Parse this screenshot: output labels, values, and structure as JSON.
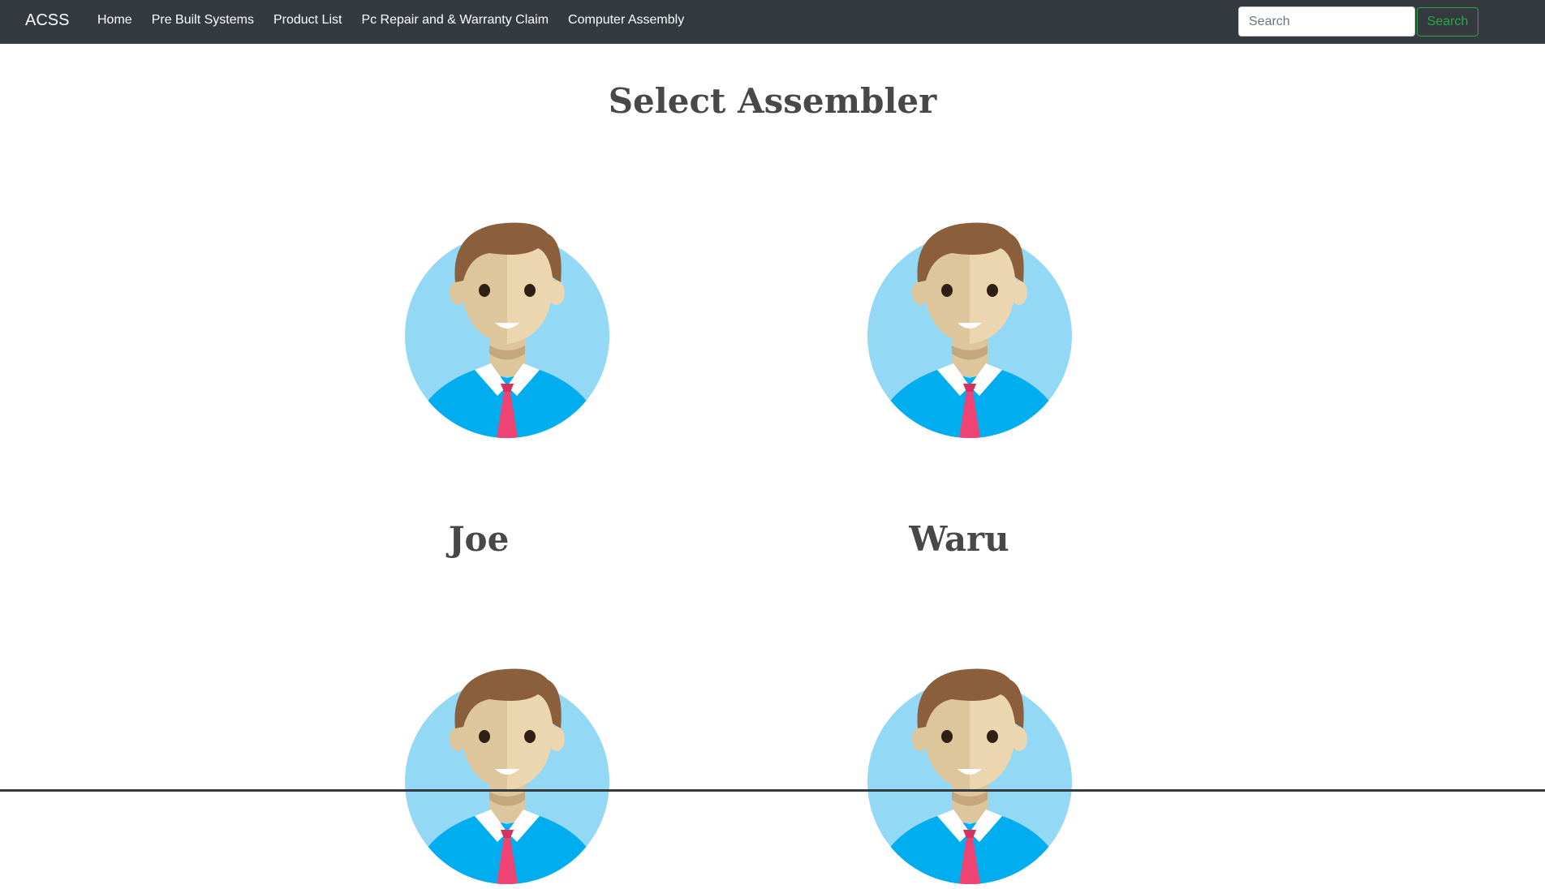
{
  "navbar": {
    "brand": "ACSS",
    "links": [
      {
        "label": "Home"
      },
      {
        "label": "Pre Built Systems"
      },
      {
        "label": "Product List"
      },
      {
        "label": "Pc Repair and & Warranty Claim"
      },
      {
        "label": "Computer Assembly"
      }
    ],
    "search": {
      "placeholder": "Search",
      "value": "",
      "button_label": "Search"
    },
    "colors": {
      "background": "#343a40",
      "search_button": "#28a745"
    }
  },
  "main": {
    "title": "Select Assembler",
    "assemblers": [
      {
        "name": "Joe",
        "avatar_icon": "male-avatar-icon"
      },
      {
        "name": "Waru",
        "avatar_icon": "male-avatar-icon"
      },
      {
        "name": "",
        "avatar_icon": "male-avatar-icon"
      },
      {
        "name": "",
        "avatar_icon": "male-avatar-icon"
      }
    ],
    "colors": {
      "avatar_circle": "#93d9f6",
      "shirt": "#00adee",
      "tie": "#ef4373",
      "hair": "#8b5e3c",
      "skin": "#ecd6b0"
    }
  }
}
